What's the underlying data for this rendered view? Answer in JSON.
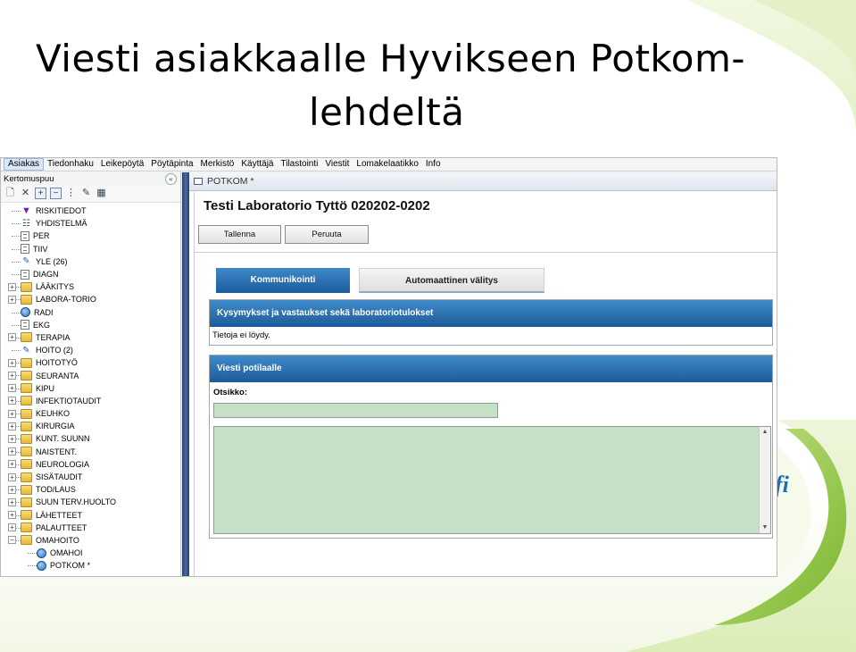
{
  "slide": {
    "title_line1": "Viesti asiakkaalle Hyvikseen Potkom-",
    "title_line2": "lehdeltä",
    "logo_text": "fi"
  },
  "menu": {
    "items": [
      "Asiakas",
      "Tiedonhaku",
      "Leikepöytä",
      "Pöytäpinta",
      "Merkistö",
      "Käyttäjä",
      "Tilastointi",
      "Viestit",
      "Lomakelaatikko",
      "Info"
    ]
  },
  "sidebar": {
    "title": "Kertomuspuu",
    "collapse_glyph": "«",
    "tree": [
      {
        "label": "RISKITIEDOT",
        "icon": "warning-icon",
        "level": 0
      },
      {
        "label": "YHDISTELMÄ",
        "icon": "summary-icon",
        "level": 0
      },
      {
        "label": "PER",
        "icon": "document-icon",
        "level": 0
      },
      {
        "label": "TIIV",
        "icon": "document-icon",
        "level": 0
      },
      {
        "label": "YLE (26)",
        "icon": "pen-icon",
        "level": 0
      },
      {
        "label": "DIAGN",
        "icon": "document-icon",
        "level": 0
      },
      {
        "label": "LÄÄKITYS",
        "icon": "folder-icon",
        "level": 0,
        "expandable": true
      },
      {
        "label": "LABORA-TORIO",
        "icon": "folder-icon",
        "level": 0,
        "expandable": true
      },
      {
        "label": "RADI",
        "icon": "globe-icon",
        "level": 0
      },
      {
        "label": "EKG",
        "icon": "document-icon",
        "level": 0
      },
      {
        "label": "TERAPIA",
        "icon": "folder-icon",
        "level": 0,
        "expandable": true
      },
      {
        "label": "HOITO (2)",
        "icon": "pen-icon",
        "level": 0
      },
      {
        "label": "HOITOTYÖ",
        "icon": "folder-icon",
        "level": 0,
        "expandable": true
      },
      {
        "label": "SEURANTA",
        "icon": "folder-icon",
        "level": 0,
        "expandable": true
      },
      {
        "label": "KIPU",
        "icon": "folder-icon",
        "level": 0,
        "expandable": true
      },
      {
        "label": "INFEKTIOTAUDIT",
        "icon": "folder-icon",
        "level": 0,
        "expandable": true
      },
      {
        "label": "KEUHKO",
        "icon": "folder-icon",
        "level": 0,
        "expandable": true
      },
      {
        "label": "KIRURGIA",
        "icon": "folder-icon",
        "level": 0,
        "expandable": true
      },
      {
        "label": "KUNT. SUUNN",
        "icon": "folder-icon",
        "level": 0,
        "expandable": true
      },
      {
        "label": "NAISTENT.",
        "icon": "folder-icon",
        "level": 0,
        "expandable": true
      },
      {
        "label": "NEUROLOGIA",
        "icon": "folder-icon",
        "level": 0,
        "expandable": true
      },
      {
        "label": "SISÄTAUDIT",
        "icon": "folder-icon",
        "level": 0,
        "expandable": true
      },
      {
        "label": "TOD/LAUS",
        "icon": "folder-icon",
        "level": 0,
        "expandable": true
      },
      {
        "label": "SUUN TERV.HUOLTO",
        "icon": "folder-icon",
        "level": 0,
        "expandable": true
      },
      {
        "label": "LÄHETTEET",
        "icon": "folder-icon",
        "level": 0,
        "expandable": true
      },
      {
        "label": "PALAUTTEET",
        "icon": "folder-icon",
        "level": 0,
        "expandable": true
      },
      {
        "label": "OMAHOITO",
        "icon": "folder-icon",
        "level": 0,
        "expandable": true,
        "expanded": true
      },
      {
        "label": "OMAHOI",
        "icon": "globe-icon",
        "level": 1
      },
      {
        "label": "POTKOM *",
        "icon": "globe-icon",
        "level": 1
      }
    ]
  },
  "document": {
    "tab_label": "POTKOM *",
    "patient_title": "Testi Laboratorio Tyttö 020202-0202",
    "save_label": "Tallenna",
    "cancel_label": "Peruuta",
    "tabs": {
      "active": "Kommunikointi",
      "other": "Automaattinen välitys"
    },
    "qa_panel": {
      "header": "Kysymykset ja vastaukset sekä laboratoriotulokset",
      "body": "Tietoja ei löydy."
    },
    "message_panel": {
      "header": "Viesti potilaalle",
      "subject_label": "Otsikko:",
      "subject_value": "",
      "message_value": ""
    }
  },
  "colors": {
    "panel_header": "#1d5b99",
    "input_bg": "#c6e0c8",
    "splitter": "#2b3f69",
    "accent_green": "#8cc63f"
  }
}
